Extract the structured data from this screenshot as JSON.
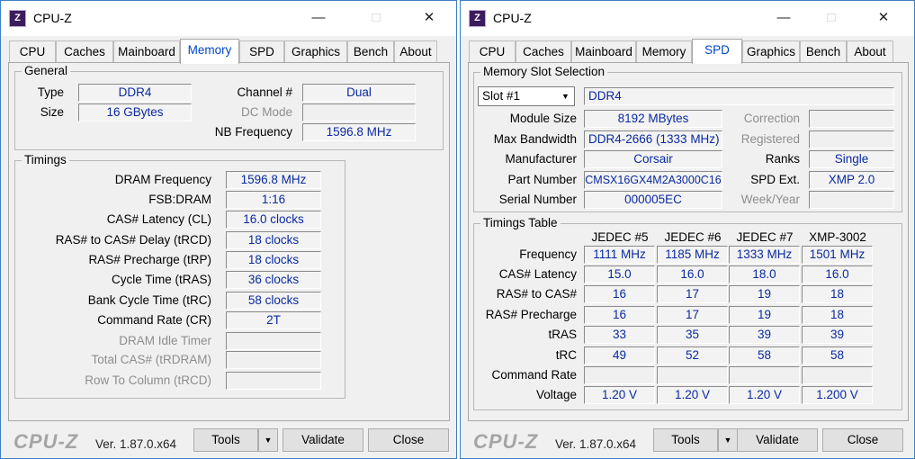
{
  "window1": {
    "title": "CPU-Z",
    "tabs": [
      "CPU",
      "Caches",
      "Mainboard",
      "Memory",
      "SPD",
      "Graphics",
      "Bench",
      "About"
    ],
    "active_tab": "Memory",
    "general": {
      "title": "General",
      "type_label": "Type",
      "type_value": "DDR4",
      "size_label": "Size",
      "size_value": "16 GBytes",
      "channel_label": "Channel #",
      "channel_value": "Dual",
      "dcmode_label": "DC Mode",
      "dcmode_value": "",
      "nbfreq_label": "NB Frequency",
      "nbfreq_value": "1596.8 MHz"
    },
    "timings": {
      "title": "Timings",
      "rows": [
        {
          "label": "DRAM Frequency",
          "value": "1596.8 MHz"
        },
        {
          "label": "FSB:DRAM",
          "value": "1:16"
        },
        {
          "label": "CAS# Latency (CL)",
          "value": "16.0 clocks"
        },
        {
          "label": "RAS# to CAS# Delay (tRCD)",
          "value": "18 clocks"
        },
        {
          "label": "RAS# Precharge (tRP)",
          "value": "18 clocks"
        },
        {
          "label": "Cycle Time (tRAS)",
          "value": "36 clocks"
        },
        {
          "label": "Bank Cycle Time (tRC)",
          "value": "58 clocks"
        },
        {
          "label": "Command Rate (CR)",
          "value": "2T"
        },
        {
          "label": "DRAM Idle Timer",
          "value": ""
        },
        {
          "label": "Total CAS# (tRDRAM)",
          "value": ""
        },
        {
          "label": "Row To Column (tRCD)",
          "value": ""
        }
      ]
    }
  },
  "window2": {
    "title": "CPU-Z",
    "tabs": [
      "CPU",
      "Caches",
      "Mainboard",
      "Memory",
      "SPD",
      "Graphics",
      "Bench",
      "About"
    ],
    "active_tab": "SPD",
    "slot": {
      "title": "Memory Slot Selection",
      "selected": "Slot #1",
      "type": "DDR4",
      "module_size_label": "Module Size",
      "module_size": "8192 MBytes",
      "bandwidth_label": "Max Bandwidth",
      "bandwidth": "DDR4-2666 (1333 MHz)",
      "manufacturer_label": "Manufacturer",
      "manufacturer": "Corsair",
      "part_label": "Part Number",
      "part": "CMSX16GX4M2A3000C16",
      "serial_label": "Serial Number",
      "serial": "000005EC",
      "correction_label": "Correction",
      "correction": "",
      "registered_label": "Registered",
      "registered": "",
      "ranks_label": "Ranks",
      "ranks": "Single",
      "spdext_label": "SPD Ext.",
      "spdext": "XMP 2.0",
      "weekyear_label": "Week/Year",
      "weekyear": ""
    },
    "timings_table": {
      "title": "Timings Table",
      "columns": [
        "JEDEC #5",
        "JEDEC #6",
        "JEDEC #7",
        "XMP-3002"
      ],
      "rows": [
        {
          "label": "Frequency",
          "values": [
            "1111 MHz",
            "1185 MHz",
            "1333 MHz",
            "1501 MHz"
          ]
        },
        {
          "label": "CAS# Latency",
          "values": [
            "15.0",
            "16.0",
            "18.0",
            "16.0"
          ]
        },
        {
          "label": "RAS# to CAS#",
          "values": [
            "16",
            "17",
            "19",
            "18"
          ]
        },
        {
          "label": "RAS# Precharge",
          "values": [
            "16",
            "17",
            "19",
            "18"
          ]
        },
        {
          "label": "tRAS",
          "values": [
            "33",
            "35",
            "39",
            "39"
          ]
        },
        {
          "label": "tRC",
          "values": [
            "49",
            "52",
            "58",
            "58"
          ]
        },
        {
          "label": "Command Rate",
          "values": [
            "",
            "",
            "",
            ""
          ]
        },
        {
          "label": "Voltage",
          "values": [
            "1.20 V",
            "1.20 V",
            "1.20 V",
            "1.200 V"
          ]
        }
      ]
    }
  },
  "footer": {
    "brand": "CPU-Z",
    "version": "Ver. 1.87.0.x64",
    "tools": "Tools",
    "validate": "Validate",
    "close": "Close"
  },
  "icons": {
    "app": "cpu-z-app-icon",
    "minimize": "minimize-icon",
    "maximize": "maximize-icon",
    "close": "close-icon",
    "dropdown": "dropdown-arrow-icon"
  },
  "colors": {
    "value_text": "#0a2aa0",
    "active_tab_text": "#0046c8",
    "window_border": "#3d7fc4"
  }
}
